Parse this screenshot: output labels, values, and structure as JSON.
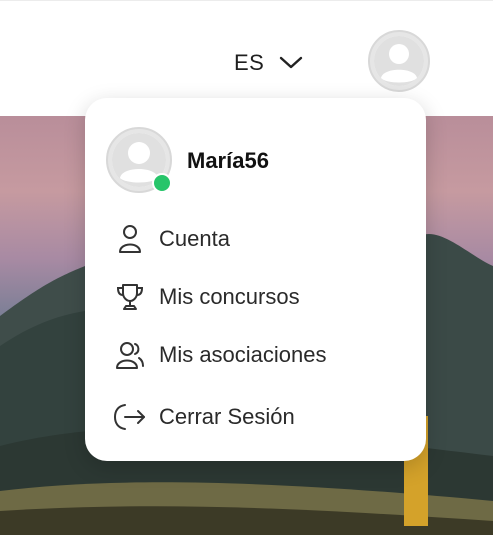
{
  "header": {
    "language": "ES",
    "chevron_icon": "chevron-down-icon",
    "avatar_icon": "user-avatar-icon"
  },
  "menu": {
    "username": "María56",
    "status": "online",
    "status_color": "#27c56a",
    "items": [
      {
        "label": "Cuenta",
        "icon": "user-icon"
      },
      {
        "label": "Mis concursos",
        "icon": "trophy-icon"
      },
      {
        "label": "Mis asociaciones",
        "icon": "users-icon"
      },
      {
        "label": "Cerrar Sesión",
        "icon": "logout-icon"
      }
    ]
  }
}
